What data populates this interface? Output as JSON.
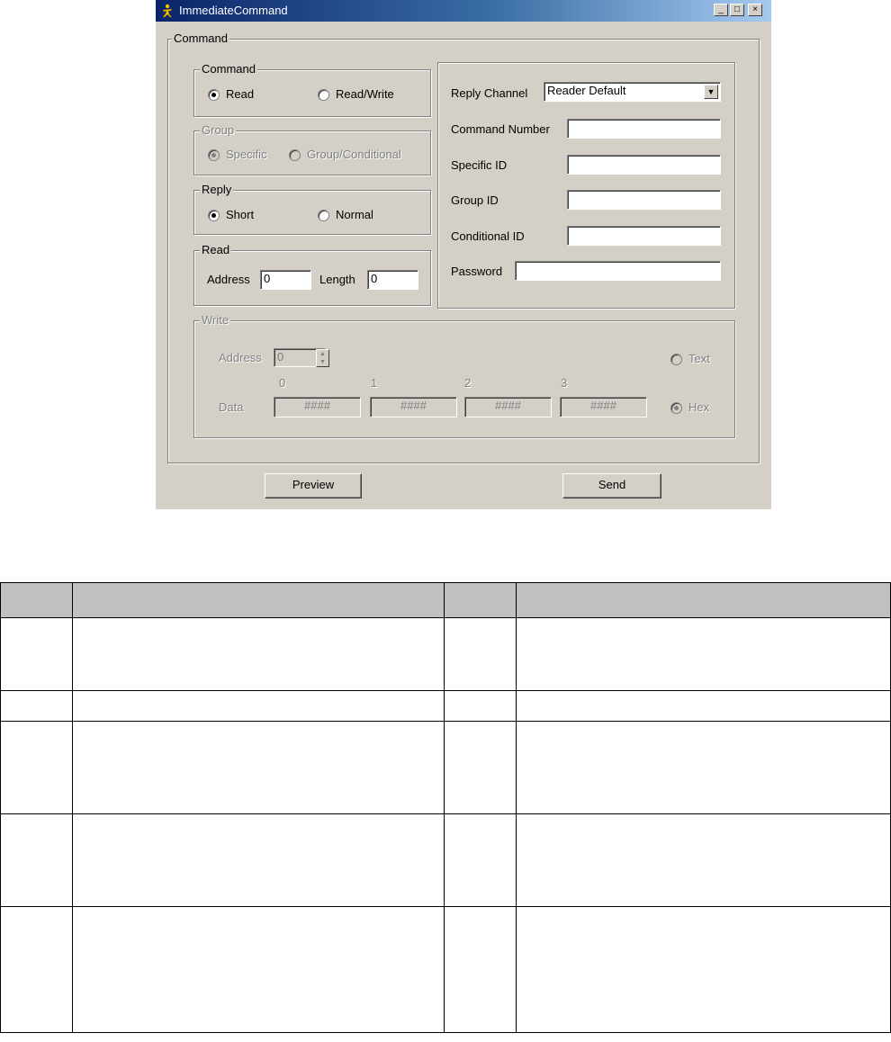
{
  "window": {
    "title": "ImmediateCommand",
    "minimize_glyph": "_",
    "maximize_glyph": "□",
    "close_glyph": "×",
    "app_icon": "person-icon"
  },
  "outer_group": {
    "legend": "Command"
  },
  "command_group": {
    "legend": "Command",
    "options": [
      {
        "label": "Read",
        "selected": true
      },
      {
        "label": "Read/Write",
        "selected": false
      }
    ]
  },
  "group_group": {
    "legend": "Group",
    "options": [
      {
        "label": "Specific",
        "selected": true
      },
      {
        "label": "Group/Conditional",
        "selected": false
      }
    ]
  },
  "reply_group": {
    "legend": "Reply",
    "options": [
      {
        "label": "Short",
        "selected": true
      },
      {
        "label": "Normal",
        "selected": false
      }
    ]
  },
  "read_group": {
    "legend": "Read",
    "address_label": "Address",
    "address_value": "0",
    "length_label": "Length",
    "length_value": "0"
  },
  "right_panel": {
    "reply_channel_label": "Reply Channel",
    "reply_channel_value": "Reader Default",
    "command_number_label": "Command Number",
    "specific_id_label": "Specific ID",
    "group_id_label": "Group ID",
    "conditional_id_label": "Conditional ID",
    "password_label": "Password"
  },
  "write_group": {
    "legend": "Write",
    "address_label": "Address",
    "address_value": "0",
    "data_label": "Data",
    "indices": [
      "0",
      "1",
      "2",
      "3"
    ],
    "data_values": [
      "####",
      "####",
      "####",
      "####"
    ],
    "text_label": "Text",
    "hex_label": "Hex",
    "mode_selected": "Hex"
  },
  "buttons": {
    "preview": "Preview",
    "send": "Send"
  }
}
